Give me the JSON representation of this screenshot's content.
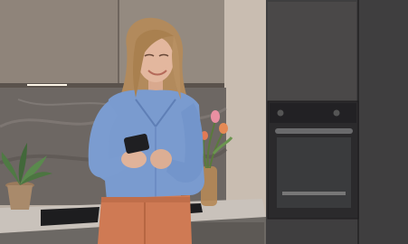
{
  "image": {
    "subject": "woman-using-smartphone-in-kitchen",
    "colors": {
      "background_frame": "#e9e9e9",
      "upper_cabinets": "#8f847a",
      "wall_panel": "#c9bdb1",
      "tall_cabinet": "#3f3e3f",
      "oven_body": "#2b2a2c",
      "oven_glass": "#3a3b3d",
      "backsplash_marble": "#6d6763",
      "countertop": "#c9c2bb",
      "sink": "#1d1d1f",
      "shirt": "#7a9bcf",
      "pants": "#cf7a54",
      "hair": "#b28a5c",
      "skin": "#e0b39a",
      "tulip_pink": "#e98fa2",
      "tulip_orange": "#e58a55",
      "plant_green": "#4f7a44",
      "vase": "#b58856"
    }
  }
}
